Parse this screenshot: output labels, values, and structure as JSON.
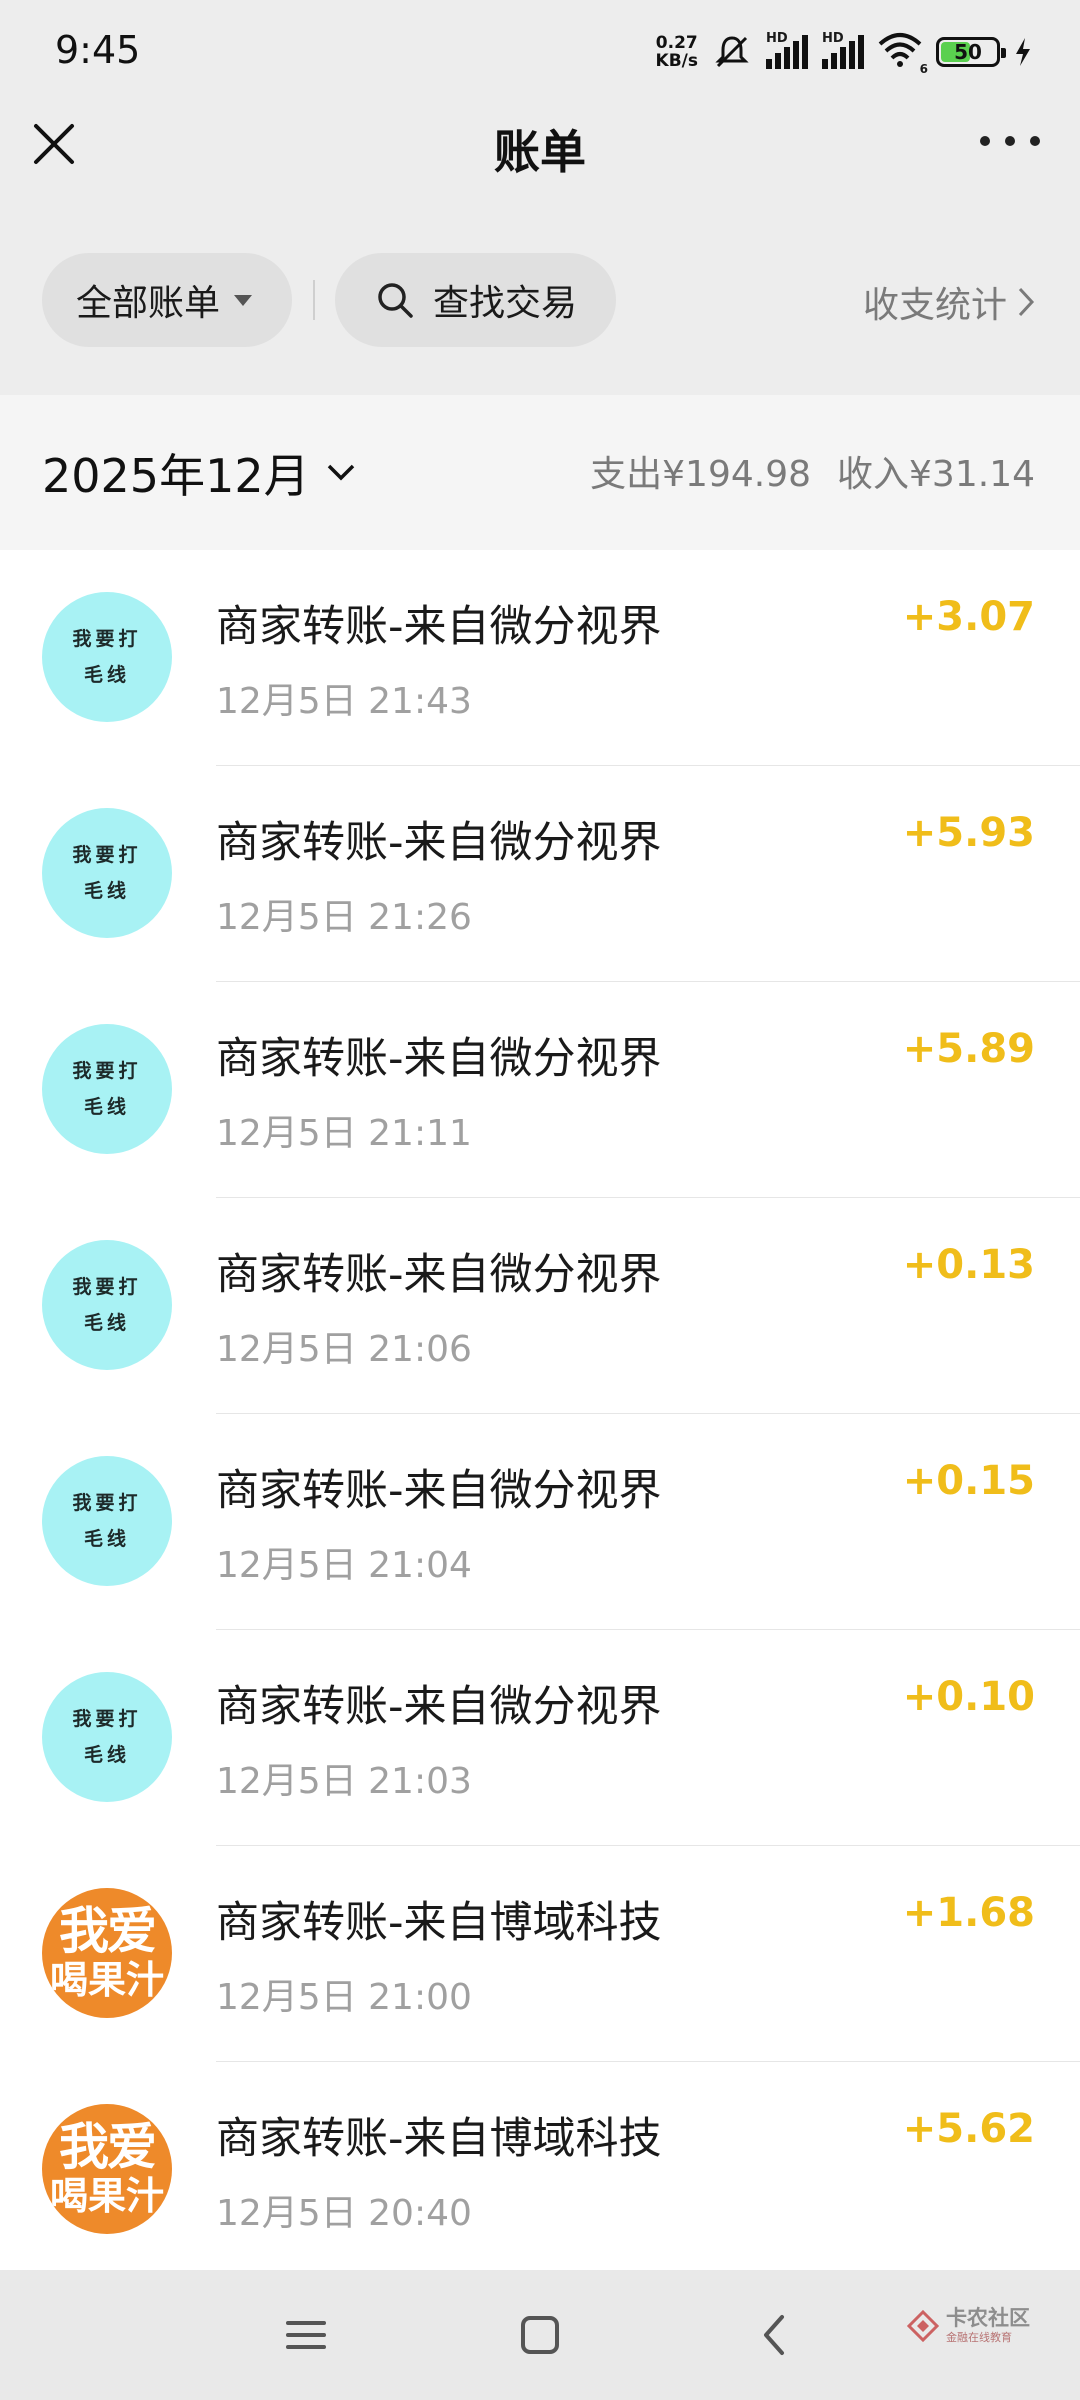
{
  "status_bar": {
    "time": "9:45",
    "net_speed_value": "0.27",
    "net_speed_unit": "KB/s",
    "signal_label_1": "HD",
    "signal_label_2": "HD",
    "wifi_badge": "6",
    "battery_level": "50",
    "icons": [
      "mute-icon",
      "signal-icon",
      "signal-icon",
      "wifi-icon",
      "battery-icon",
      "charging-icon"
    ]
  },
  "header": {
    "title": "账单",
    "close_icon": "close-icon",
    "more_icon": "more-icon"
  },
  "filter_bar": {
    "all_bills_label": "全部账单",
    "search_label": "查找交易",
    "stats_label": "收支统计"
  },
  "month_bar": {
    "month_label": "2025年12月",
    "expense_label": "支出",
    "expense_value": "¥194.98",
    "income_label": "收入",
    "income_value": "¥31.14"
  },
  "transactions": [
    {
      "avatar_type": "cyan",
      "avatar_line1": "我要打",
      "avatar_line2": "毛线",
      "title": "商家转账-来自微分视界",
      "time": "12月5日 21:43",
      "amount": "+3.07"
    },
    {
      "avatar_type": "cyan",
      "avatar_line1": "我要打",
      "avatar_line2": "毛线",
      "title": "商家转账-来自微分视界",
      "time": "12月5日 21:26",
      "amount": "+5.93"
    },
    {
      "avatar_type": "cyan",
      "avatar_line1": "我要打",
      "avatar_line2": "毛线",
      "title": "商家转账-来自微分视界",
      "time": "12月5日 21:11",
      "amount": "+5.89"
    },
    {
      "avatar_type": "cyan",
      "avatar_line1": "我要打",
      "avatar_line2": "毛线",
      "title": "商家转账-来自微分视界",
      "time": "12月5日 21:06",
      "amount": "+0.13"
    },
    {
      "avatar_type": "cyan",
      "avatar_line1": "我要打",
      "avatar_line2": "毛线",
      "title": "商家转账-来自微分视界",
      "time": "12月5日 21:04",
      "amount": "+0.15"
    },
    {
      "avatar_type": "cyan",
      "avatar_line1": "我要打",
      "avatar_line2": "毛线",
      "title": "商家转账-来自微分视界",
      "time": "12月5日 21:03",
      "amount": "+0.10"
    },
    {
      "avatar_type": "orange",
      "avatar_line1": "我爱",
      "avatar_line2": "喝果汁",
      "title": "商家转账-来自博域科技",
      "time": "12月5日 21:00",
      "amount": "+1.68"
    },
    {
      "avatar_type": "orange",
      "avatar_line1": "我爱",
      "avatar_line2": "喝果汁",
      "title": "商家转账-来自博域科技",
      "time": "12月5日 20:40",
      "amount": "+5.62"
    }
  ],
  "nav_bar": {
    "menu_icon": "menu-icon",
    "home_icon": "home-icon",
    "back_icon": "back-icon",
    "watermark_text": "卡农社区",
    "watermark_sub": "金融在线教育"
  },
  "colors": {
    "amount": "#f0bd1a",
    "avatar_cyan": "#a8f2f4",
    "avatar_orange": "#ee8a2a",
    "page_bg": "#ededed"
  }
}
